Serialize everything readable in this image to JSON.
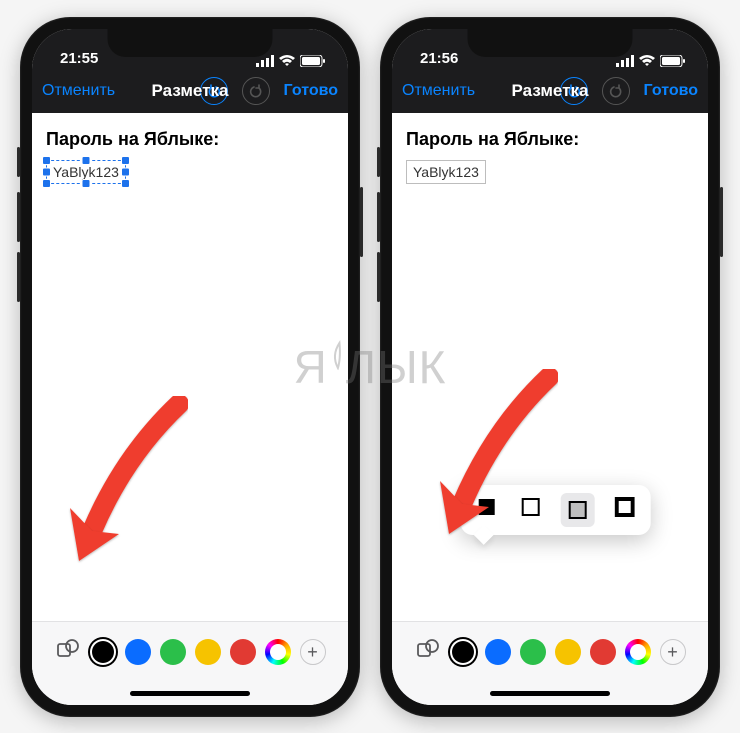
{
  "watermark": {
    "text_left": "Я",
    "text_right": "ЛЫК"
  },
  "phones": [
    {
      "status": {
        "time": "21:55"
      },
      "nav": {
        "cancel": "Отменить",
        "title": "Разметка",
        "done": "Готово"
      },
      "note": {
        "heading": "Пароль на Яблыке:",
        "textbox_value": "YaBlyk123",
        "textbox_selected": true
      },
      "toolbar": {
        "colors": [
          "#000000",
          "#0a6cff",
          "#2bbf4a",
          "#f6c300",
          "#e13a33"
        ],
        "selected_color_index": 0,
        "shape_popover_visible": false
      }
    },
    {
      "status": {
        "time": "21:56"
      },
      "nav": {
        "cancel": "Отменить",
        "title": "Разметка",
        "done": "Готово"
      },
      "note": {
        "heading": "Пароль на Яблыке:",
        "textbox_value": "YaBlyk123",
        "textbox_selected": false
      },
      "toolbar": {
        "colors": [
          "#000000",
          "#0a6cff",
          "#2bbf4a",
          "#f6c300",
          "#e13a33"
        ],
        "selected_color_index": 0,
        "shape_popover_visible": true,
        "shape_options": [
          "square-filled",
          "square-outline",
          "square-semi",
          "square-thick"
        ],
        "shape_selected_index": 2
      }
    }
  ]
}
